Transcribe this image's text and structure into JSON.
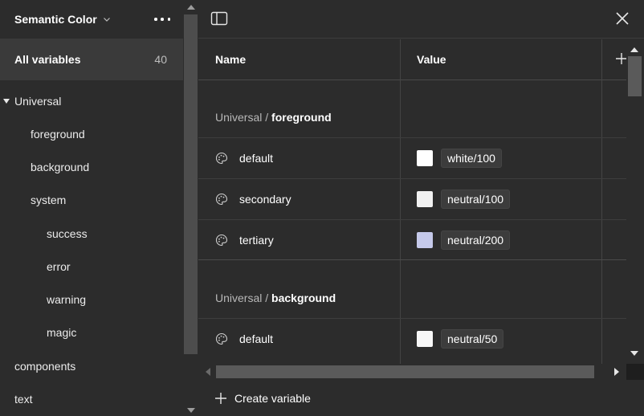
{
  "sidebar": {
    "title": "Semantic Color",
    "all_variables": {
      "label": "All variables",
      "count": "40"
    },
    "items": [
      {
        "label": "Universal",
        "expanded": true
      },
      {
        "label": "foreground"
      },
      {
        "label": "background"
      },
      {
        "label": "system"
      },
      {
        "label": "success"
      },
      {
        "label": "error"
      },
      {
        "label": "warning"
      },
      {
        "label": "magic"
      },
      {
        "label": "components"
      },
      {
        "label": "text"
      }
    ]
  },
  "table": {
    "headers": {
      "name": "Name",
      "value": "Value"
    },
    "groups": [
      {
        "prefix": "Universal",
        "separator": " / ",
        "name": "foreground",
        "rows": [
          {
            "name": "default",
            "value": "white/100",
            "color": "#ffffff"
          },
          {
            "name": "secondary",
            "value": "neutral/100",
            "color": "#f1f1f1"
          },
          {
            "name": "tertiary",
            "value": "neutral/200",
            "color": "#c5c9ea"
          }
        ]
      },
      {
        "prefix": "Universal",
        "separator": " / ",
        "name": "background",
        "rows": [
          {
            "name": "default",
            "value": "neutral/50",
            "color": "#f7f7f7"
          }
        ]
      }
    ]
  },
  "footer": {
    "create_label": "Create variable"
  },
  "icons": {
    "sidebar_toggle": "panel-left-icon",
    "close": "close-icon",
    "more": "more-horizontal-icon",
    "chevron": "chevron-down-icon",
    "variable": "palette-icon",
    "add": "plus-icon"
  },
  "theme": {
    "background": "#2c2c2c",
    "selected": "#3a3a3a",
    "text": "#ffffff"
  }
}
